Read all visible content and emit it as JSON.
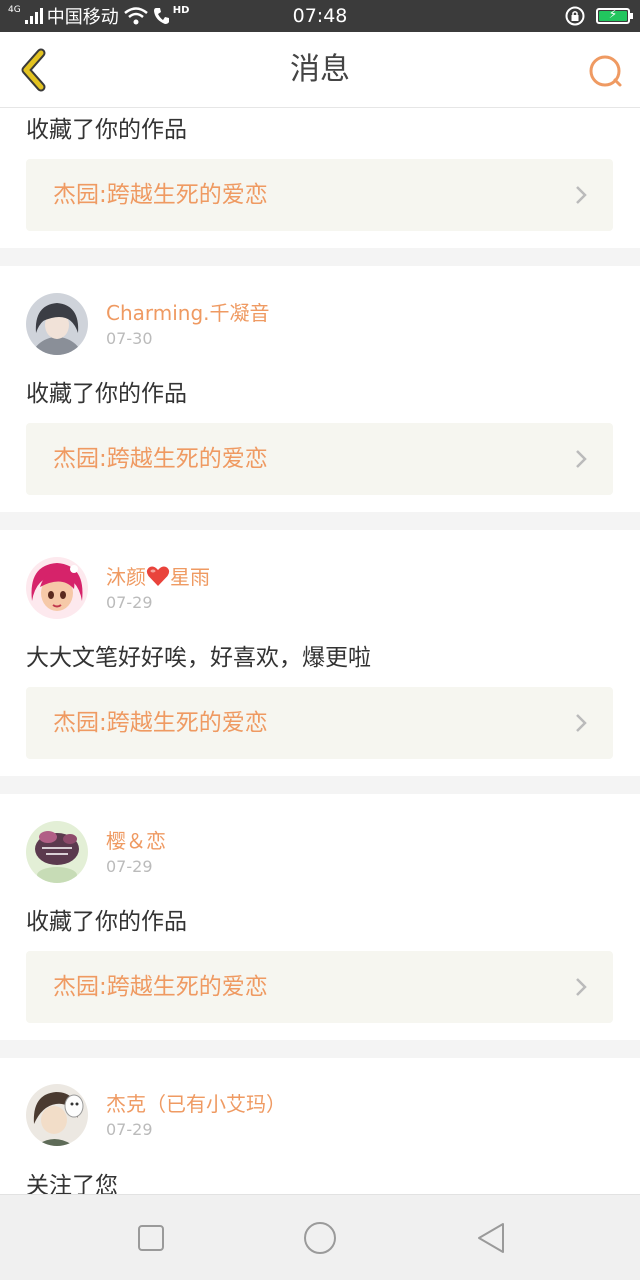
{
  "status_bar": {
    "network": "4G",
    "carrier": "中国移动",
    "hd": "HD",
    "time": "07:48"
  },
  "header": {
    "title": "消息"
  },
  "colors": {
    "accent": "#ef9a62",
    "back_arrow": "#e3c321",
    "link_bg": "#f6f6f0"
  },
  "messages": [
    {
      "text": "收藏了你的作品",
      "work_title": "杰园:跨越生死的爱恋"
    },
    {
      "user": "Charming.千凝音",
      "date": "07-30",
      "text": "收藏了你的作品",
      "work_title": "杰园:跨越生死的爱恋"
    },
    {
      "user_part1": "沐颜",
      "user_part2": "星雨",
      "date": "07-29",
      "text": "大大文笔好好唉，好喜欢，爆更啦",
      "work_title": "杰园:跨越生死的爱恋"
    },
    {
      "user": "樱＆恋",
      "date": "07-29",
      "text": "收藏了你的作品",
      "work_title": "杰园:跨越生死的爱恋"
    },
    {
      "user": "杰克（已有小艾玛）",
      "date": "07-29",
      "text": "关注了您"
    }
  ],
  "icons": {
    "back": "chevron-left-icon",
    "search": "search-icon",
    "chevron": "chevron-right-icon",
    "heart": "heart-icon",
    "nav_recent": "square-icon",
    "nav_home": "circle-icon",
    "nav_back": "triangle-back-icon"
  }
}
